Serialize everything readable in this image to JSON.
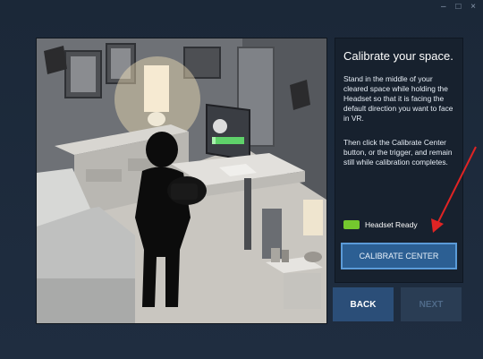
{
  "window": {
    "controls": "– □ ×"
  },
  "panel": {
    "title": "Calibrate your space.",
    "instructions_1": "Stand in the middle of your cleared space while holding the Headset so that it is facing the default direction you want to face in VR.",
    "instructions_2": "Then click the Calibrate Center button, or the trigger, and remain still while calibration completes.",
    "status_label": "Headset Ready",
    "status_color": "#74c82e",
    "calibrate_label": "CALIBRATE CENTER"
  },
  "nav": {
    "back_label": "BACK",
    "next_label": "NEXT"
  },
  "annotation": {
    "arrow_color": "#e02424"
  }
}
